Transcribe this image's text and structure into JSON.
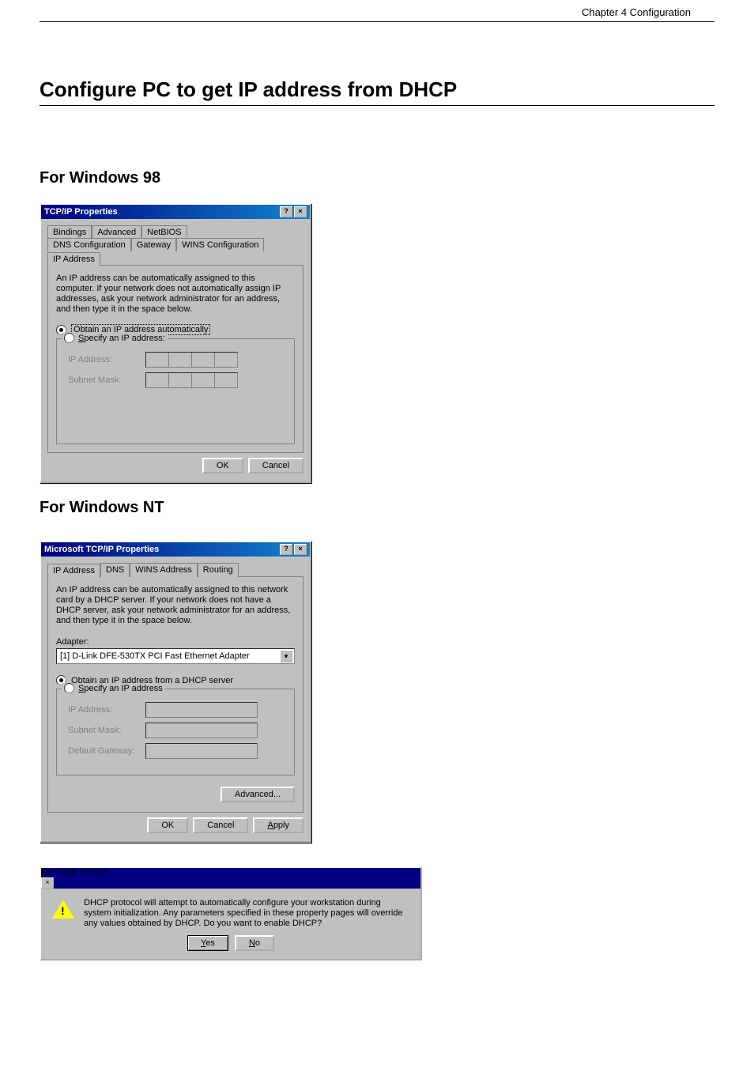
{
  "chapter": "Chapter 4 Configuration",
  "h1": "Configure PC to get IP address from DHCP",
  "section98": "For Windows 98",
  "sectionNT": "For Windows NT",
  "dlg98": {
    "title": "TCP/IP Properties",
    "tabs_row1": [
      "Bindings",
      "Advanced",
      "NetBIOS"
    ],
    "tabs_row2": [
      "DNS Configuration",
      "Gateway",
      "WINS Configuration",
      "IP Address"
    ],
    "active_tab": "IP Address",
    "desc": "An IP address can be automatically assigned to this computer. If your network does not automatically assign IP addresses, ask your network administrator for an address, and then type it in the space below.",
    "radio_auto": "Obtain an IP address automatically",
    "radio_specify": "Specify an IP address:",
    "ip_label": "IP Address:",
    "subnet_label": "Subnet Mask:",
    "ok": "OK",
    "cancel": "Cancel"
  },
  "dlgNT": {
    "title": "Microsoft TCP/IP Properties",
    "tabs": [
      "IP Address",
      "DNS",
      "WINS Address",
      "Routing"
    ],
    "active_tab": "IP Address",
    "desc": "An IP address can be automatically assigned to this network card by a DHCP server. If your network does not have a DHCP server, ask your network administrator for an address, and then type it in the space below.",
    "adapter_label": "Adapter:",
    "adapter_value": "[1] D-Link DFE-530TX PCI Fast Ethernet Adapter",
    "radio_auto": "Obtain an IP address from a DHCP server",
    "radio_specify": "Specify an IP address",
    "ip_label": "IP Address:",
    "subnet_label": "Subnet Mask:",
    "gateway_label": "Default Gateway:",
    "advanced": "Advanced...",
    "ok": "OK",
    "cancel": "Cancel",
    "apply": "Apply"
  },
  "msg": {
    "title": "Microsoft TCP/IP",
    "text": "DHCP protocol will attempt to automatically configure your workstation during system initialization. Any parameters specified in these property pages will override any values obtained by DHCP. Do you want to enable DHCP?",
    "yes": "Yes",
    "no": "No"
  }
}
